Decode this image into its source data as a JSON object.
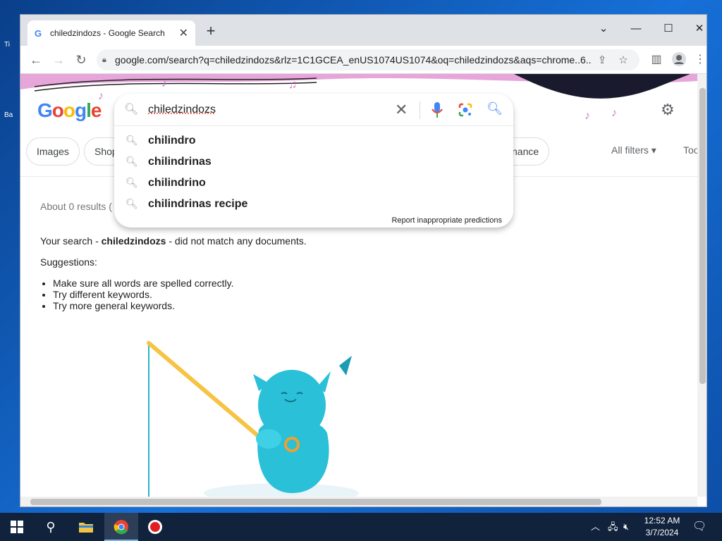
{
  "desktop": {
    "icon_labels": [
      "Ti",
      "Ba"
    ]
  },
  "browser": {
    "tab_title": "chiledzindozs - Google Search",
    "tab_close": "✕",
    "new_tab": "+",
    "url": "google.com/search?q=chiledzindozs&rlz=1C1GCEA_enUS1074US1074&oq=chiledzindozs&aqs=chrome..6..."
  },
  "google": {
    "logo": [
      "G",
      "o",
      "o",
      "g",
      "l",
      "e"
    ],
    "search_query": "chiledzindozs",
    "suggestions": [
      "chilindro",
      "chilindrinas",
      "chilindrino",
      "chilindrinas recipe"
    ],
    "report_label": "Report inappropriate predictions",
    "chips": [
      "Images",
      "Shop",
      "nance"
    ],
    "all_filters": "All filters",
    "tools": "Tools",
    "stats": "About 0 results (",
    "no_match_prefix": "Your search - ",
    "no_match_query": "chiledzindozs",
    "no_match_suffix": " - did not match any documents.",
    "suggestions_heading": "Suggestions:",
    "tips": [
      "Make sure all words are spelled correctly.",
      "Try different keywords.",
      "Try more general keywords."
    ]
  },
  "taskbar": {
    "time": "12:52 AM",
    "date": "3/7/2024"
  },
  "colors": {
    "google_blue": "#4285f4",
    "google_red": "#ea4335",
    "google_yellow": "#fbbc05",
    "google_green": "#34a853",
    "taskbar": "#10223c",
    "doodle_pink": "#e7a6d9",
    "mascot": "#29c0d8"
  }
}
